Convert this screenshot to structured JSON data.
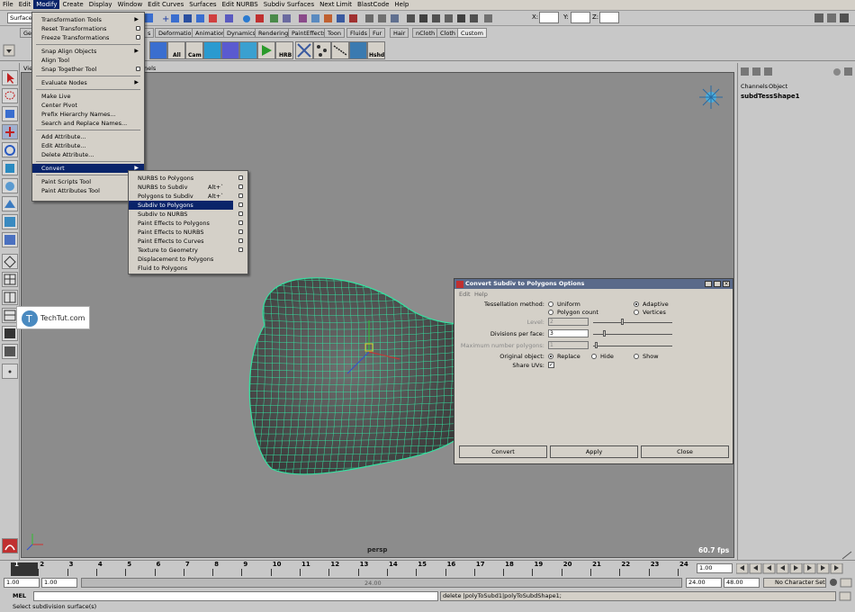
{
  "menubar": {
    "items": [
      "File",
      "Edit",
      "Modify",
      "Create",
      "Display",
      "Window",
      "Edit Curves",
      "Surfaces",
      "Edit NURBS",
      "Subdiv Surfaces",
      "Next Limit",
      "BlastCode",
      "Help"
    ]
  },
  "statusline": {
    "mode": "Surfaces",
    "x_label": "X:",
    "y_label": "Y:",
    "z_label": "Z:"
  },
  "shelf": {
    "tabs": [
      "Ge",
      "s",
      "Deformation",
      "Animation",
      "Dynamics",
      "Rendering",
      "PaintEffects",
      "Toon",
      "Fluids",
      "Fur",
      "Hair",
      "nCloth",
      "Cloth",
      "Custom"
    ],
    "labels": [
      "All",
      "Cam",
      "HRB",
      "Hshd"
    ]
  },
  "panel": {
    "menu_fragment_left": "Vie",
    "menu_fragment_right": "nels",
    "camera_label": "persp",
    "fps": "60.7 fps"
  },
  "modify_menu": {
    "items": [
      {
        "label": "Transformation Tools",
        "sub": true
      },
      {
        "label": "Reset Transformations",
        "opt": true
      },
      {
        "label": "Freeze Transformations",
        "opt": true
      },
      {
        "label": "Snap Align Objects",
        "sub": true
      },
      {
        "label": "Align Tool"
      },
      {
        "label": "Snap Together Tool",
        "opt": true
      },
      {
        "label": "Evaluate Nodes",
        "sub": true
      },
      {
        "label": "Make Live"
      },
      {
        "label": "Center Pivot"
      },
      {
        "label": "Prefix Hierarchy Names..."
      },
      {
        "label": "Search and Replace Names..."
      },
      {
        "label": "Add Attribute..."
      },
      {
        "label": "Edit Attribute..."
      },
      {
        "label": "Delete Attribute..."
      },
      {
        "label": "Convert",
        "sub": true,
        "active": true
      },
      {
        "label": "Paint Scripts Tool",
        "opt": true
      },
      {
        "label": "Paint Attributes Tool",
        "opt": true
      }
    ]
  },
  "convert_menu": {
    "items": [
      {
        "label": "NURBS to Polygons",
        "opt": true
      },
      {
        "label": "NURBS to Subdiv",
        "shortcut": "Alt+`",
        "opt": true
      },
      {
        "label": "Polygons to Subdiv",
        "shortcut": "Alt+`",
        "opt": true
      },
      {
        "label": "Subdiv to Polygons",
        "opt": true,
        "active": true
      },
      {
        "label": "Subdiv to NURBS",
        "opt": true
      },
      {
        "label": "Paint Effects to Polygons",
        "opt": true
      },
      {
        "label": "Paint Effects to NURBS",
        "opt": true
      },
      {
        "label": "Paint Effects to Curves",
        "opt": true
      },
      {
        "label": "Texture to Geometry",
        "opt": true
      },
      {
        "label": "Displacement to Polygons"
      },
      {
        "label": "Fluid to Polygons"
      }
    ]
  },
  "channel_box": {
    "tabs": [
      "Channels",
      "Object"
    ],
    "object_name": "subdTessShape1"
  },
  "dialog": {
    "title": "Convert Subdiv to Polygons Options",
    "menu": [
      "Edit",
      "Help"
    ],
    "tessellation_label": "Tessellation method:",
    "uniform_label": "Uniform",
    "adaptive_label": "Adaptive",
    "polygon_count_label": "Polygon count",
    "vertices_label": "Vertices",
    "level_label": "Level:",
    "level_value": "2",
    "divisions_label": "Divisions per face:",
    "divisions_value": "3",
    "max_polygons_label": "Maximum number polygons:",
    "max_polygons_value": "1",
    "original_label": "Original object:",
    "replace_label": "Replace",
    "hide_label": "Hide",
    "show_label": "Show",
    "share_uvs_label": "Share UVs:",
    "convert_button": "Convert",
    "apply_button": "Apply",
    "close_button": "Close",
    "slider_level": 0.35,
    "slider_divisions": 0.13,
    "slider_max": 0.02
  },
  "timeline": {
    "ticks": [
      "1",
      "2",
      "3",
      "4",
      "5",
      "6",
      "7",
      "8",
      "9",
      "10",
      "11",
      "12",
      "13",
      "14",
      "15",
      "16",
      "17",
      "18",
      "19",
      "20",
      "21",
      "22",
      "23",
      "24"
    ],
    "current_frame": "1.00"
  },
  "range": {
    "start": "1.00",
    "playback_start": "1.00",
    "range_label": "24.00",
    "playback_end": "24.00",
    "end": "48.00",
    "character_set": "No Character Set"
  },
  "command": {
    "label": "MEL",
    "result": "delete |polyToSubd1|polyToSubdShape1;"
  },
  "helpline": {
    "text": "Select subdivision surface(s)"
  },
  "watermark": {
    "text": "TechTut.com"
  },
  "colors": {
    "mesh_wire": "#35e0a0",
    "viewport_bg": "#8c8c8c",
    "highlight": "#0a246a"
  }
}
